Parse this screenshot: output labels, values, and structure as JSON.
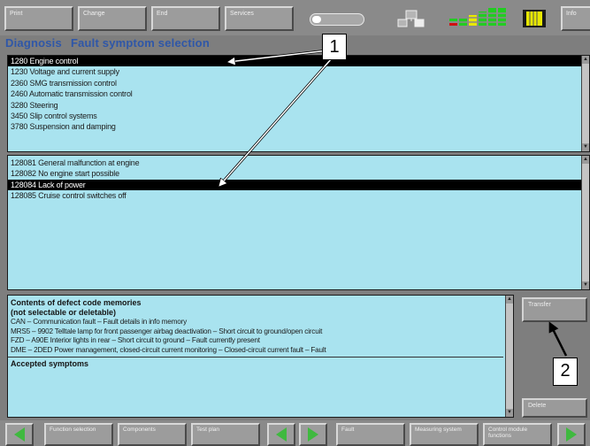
{
  "toolbar": {
    "buttons": [
      "Print",
      "Change",
      "End",
      "Services",
      "Info"
    ]
  },
  "screen_title": {
    "part1": "Diagnosis",
    "part2": "Fault symptom selection"
  },
  "system_list": [
    "1280 Engine control",
    "1230 Voltage and current supply",
    "2360 SMG transmission control",
    "2460 Automatic transmission control",
    "3280 Steering",
    "3450 Slip control systems",
    "3780 Suspension and damping"
  ],
  "symptom_list": [
    "128081 General malfunction at engine",
    "128082 No engine start possible",
    "128084 Lack of power",
    "128085 Cruise control switches off"
  ],
  "memory_panel": {
    "header_line1": "Contents of defect code memories",
    "header_line2": "(not selectable or deletable)",
    "entries": [
      "CAN – Communication fault – Fault details in info memory",
      "MRS5 – 9902 Telltale lamp for front passenger airbag deactivation – Short circuit to ground/open circuit",
      "FZD – A90E Interior lights in rear – Short circuit to ground – Fault currently present",
      "DME – 2DED Power management, closed-circuit current monitoring – Closed-circuit current fault – Fault"
    ],
    "accepted_header": "Accepted symptoms"
  },
  "side_buttons": {
    "transfer": "Transfer",
    "delete": "Delete"
  },
  "bottom_bar": {
    "buttons": [
      "Function selection",
      "Components",
      "Test plan",
      "Fault",
      "Measuring system",
      "Control module functions"
    ]
  },
  "callouts": {
    "label_1": "1",
    "label_2": "2"
  },
  "colors": {
    "panel_bg": "#a9e3ef",
    "title_blue": "#2f57a8",
    "chrome_gray": "#8a8a8a",
    "nav_green": "#3fb93f",
    "led_green": "#22cc22",
    "led_yellow": "#e8e800",
    "led_red": "#d01010"
  },
  "icons": [
    "battery-icon",
    "connection-icon",
    "status-leds-icon",
    "folder-icon",
    "nav-left-arrow-icon",
    "nav-right-arrow-icon"
  ]
}
